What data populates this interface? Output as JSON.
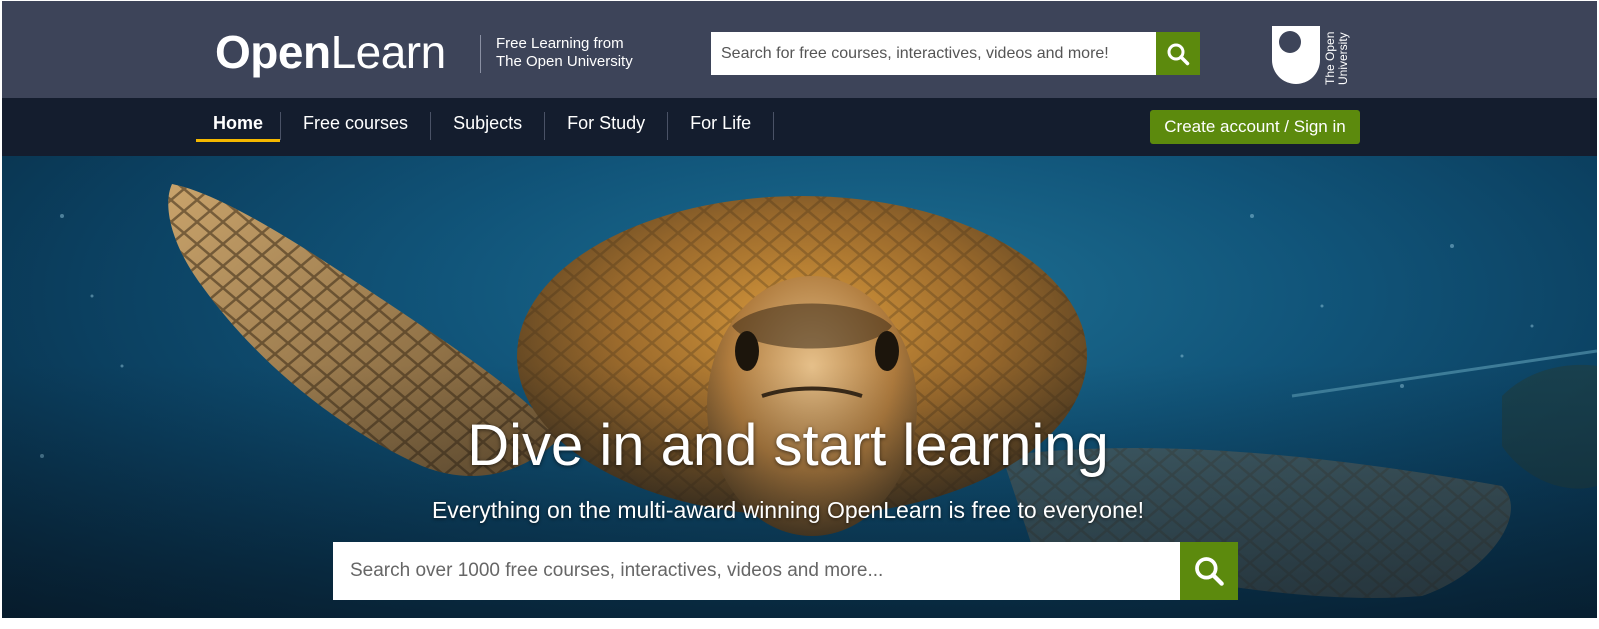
{
  "header": {
    "logo_bold": "Open",
    "logo_regular": "Learn",
    "tagline_line1": "Free Learning from",
    "tagline_line2": "The Open University",
    "search_placeholder": "Search for free courses, interactives, videos and more!",
    "search_icon": "search-icon",
    "ou_logo_line1": "The Open",
    "ou_logo_line2": "University"
  },
  "nav": {
    "items": [
      {
        "label": "Home",
        "active": true
      },
      {
        "label": "Free courses",
        "active": false
      },
      {
        "label": "Subjects",
        "active": false
      },
      {
        "label": "For Study",
        "active": false
      },
      {
        "label": "For Life",
        "active": false
      }
    ],
    "signin_label": "Create account / Sign in"
  },
  "hero": {
    "title": "Dive in and start learning",
    "subtitle": "Everything on the multi-award winning OpenLearn is free to everyone!",
    "search_placeholder": "Search over 1000 free courses, interactives, videos and more...",
    "search_icon": "search-icon"
  },
  "colors": {
    "topbar": "#3d4459",
    "nav": "#141d2e",
    "accent_green": "#5c8a0d",
    "active_underline": "#f5b800"
  }
}
